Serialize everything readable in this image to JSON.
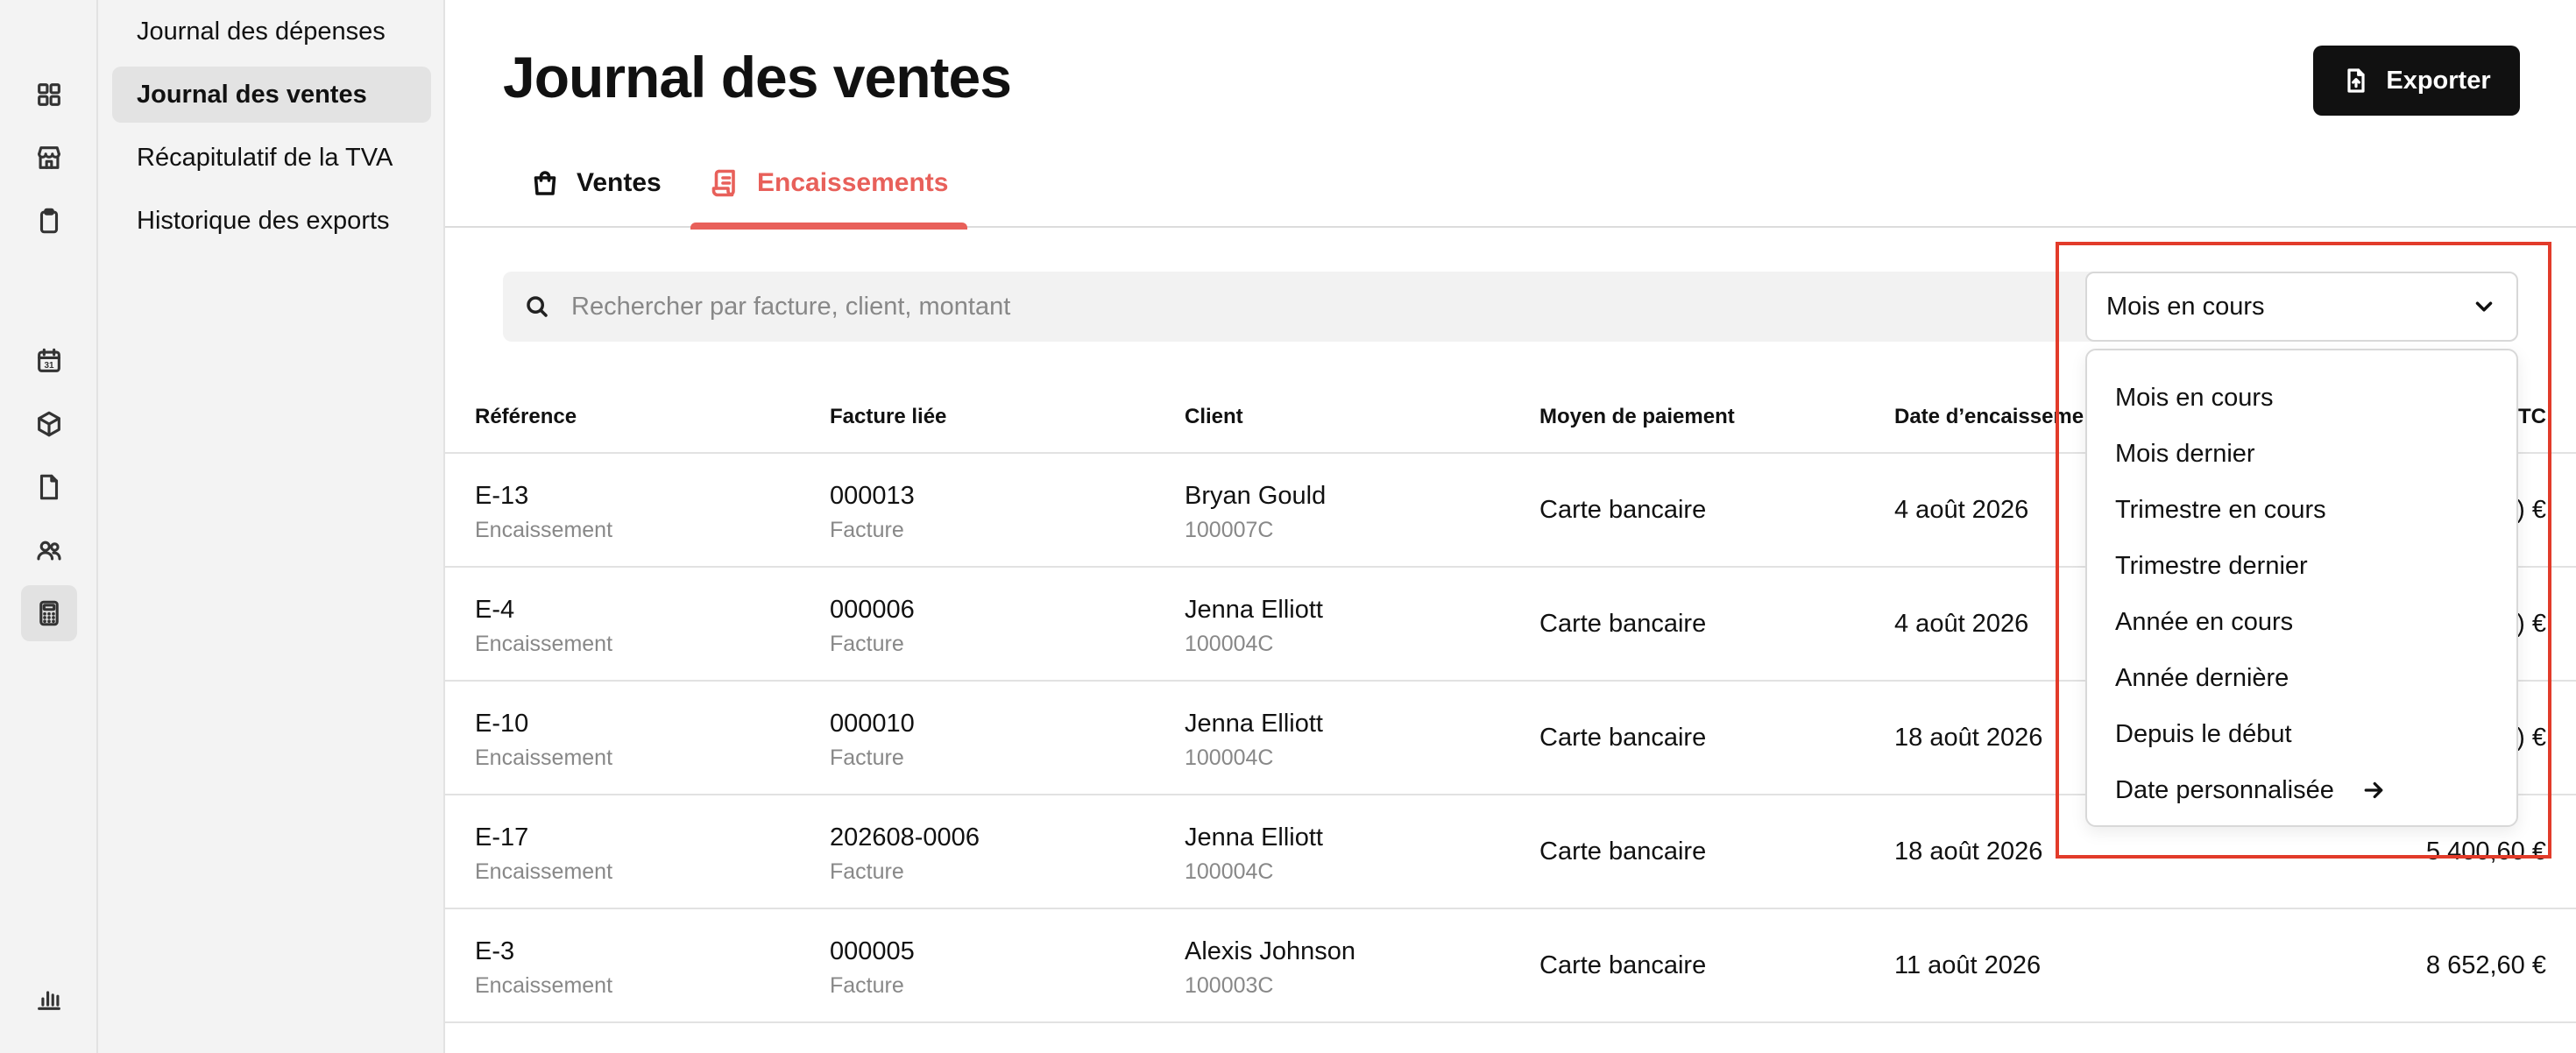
{
  "rail": {
    "icons": [
      "dashboard-icon",
      "store-icon",
      "clipboard-icon",
      "calendar-icon",
      "box-icon",
      "document-icon",
      "users-icon",
      "calculator-icon",
      "chart-icon"
    ],
    "calendar_day": "31"
  },
  "subnav": {
    "items": [
      {
        "label": "Journal des dépenses"
      },
      {
        "label": "Journal des ventes"
      },
      {
        "label": "Récapitulatif de la TVA"
      },
      {
        "label": "Historique des exports"
      }
    ]
  },
  "header": {
    "title": "Journal des ventes",
    "export_label": "Exporter"
  },
  "tabs": [
    {
      "label": "Ventes"
    },
    {
      "label": "Encaissements"
    }
  ],
  "search": {
    "placeholder": "Rechercher par facture, client, montant"
  },
  "period": {
    "selected": "Mois en cours",
    "options": [
      "Mois en cours",
      "Mois dernier",
      "Trimestre en cours",
      "Trimestre dernier",
      "Année en cours",
      "Année dernière",
      "Depuis le début",
      "Date personnalisée"
    ]
  },
  "table": {
    "headers": [
      "Référence",
      "Facture liée",
      "Client",
      "Moyen de paiement",
      "Date d’encaisseme",
      "TC"
    ],
    "rows": [
      {
        "ref": "E-13",
        "ref_sub": "Encaissement",
        "invoice": "000013",
        "invoice_sub": "Facture",
        "client": "Bryan Gould",
        "client_id": "100007C",
        "payment": "Carte bancaire",
        "date": "4 août 2026",
        "amount": ") €"
      },
      {
        "ref": "E-4",
        "ref_sub": "Encaissement",
        "invoice": "000006",
        "invoice_sub": "Facture",
        "client": "Jenna Elliott",
        "client_id": "100004C",
        "payment": "Carte bancaire",
        "date": "4 août 2026",
        "amount": ") €"
      },
      {
        "ref": "E-10",
        "ref_sub": "Encaissement",
        "invoice": "000010",
        "invoice_sub": "Facture",
        "client": "Jenna Elliott",
        "client_id": "100004C",
        "payment": "Carte bancaire",
        "date": "18 août 2026",
        "amount": ") €"
      },
      {
        "ref": "E-17",
        "ref_sub": "Encaissement",
        "invoice": "202608-0006",
        "invoice_sub": "Facture",
        "client": "Jenna Elliott",
        "client_id": "100004C",
        "payment": "Carte bancaire",
        "date": "18 août 2026",
        "amount": "5 400,60 €"
      },
      {
        "ref": "E-3",
        "ref_sub": "Encaissement",
        "invoice": "000005",
        "invoice_sub": "Facture",
        "client": "Alexis Johnson",
        "client_id": "100003C",
        "payment": "Carte bancaire",
        "date": "11 août 2026",
        "amount": "8 652,60 €"
      }
    ]
  },
  "colors": {
    "accent": "#e8605a",
    "highlight": "#e23b2a",
    "sidebar_bg": "#f3f3f3",
    "button_bg": "#111111"
  }
}
